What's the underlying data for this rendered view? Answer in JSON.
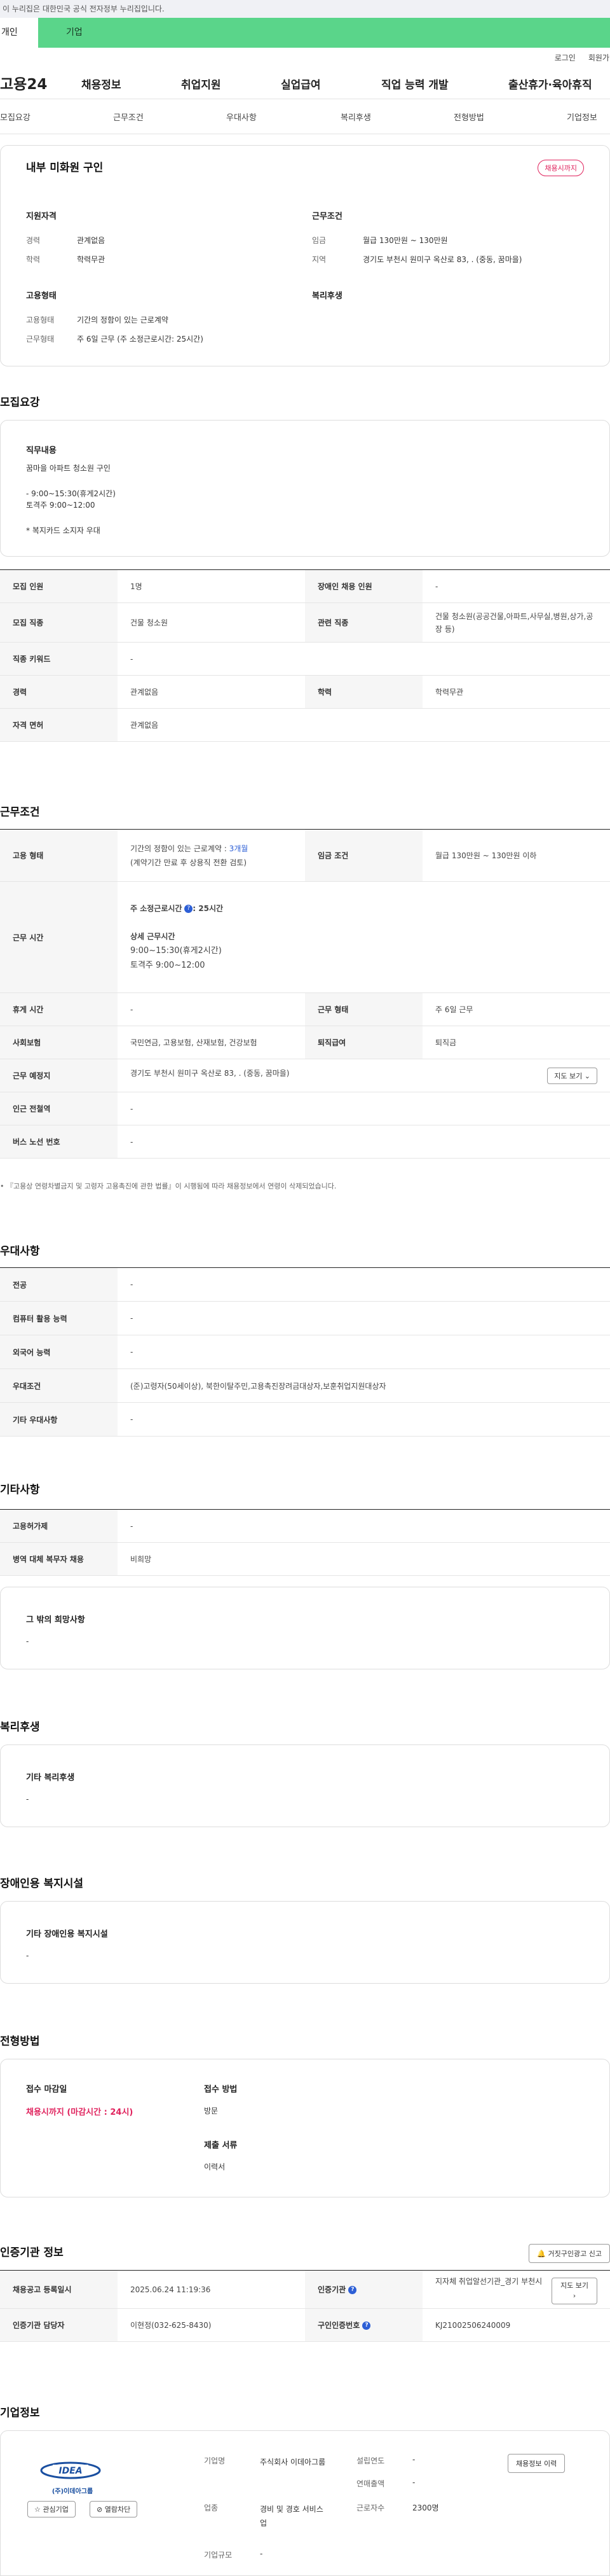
{
  "gov_banner": "이 누리집은 대한민국 공식 전자정부 누리집입니다.",
  "user_tabs": [
    "개인",
    "기업"
  ],
  "util": [
    "로그인",
    "회원가입"
  ],
  "logo": "고용24",
  "gnb": [
    "채용정보",
    "취업지원",
    "실업급여",
    "직업 능력 개발",
    "출산휴가·육아휴직"
  ],
  "snb": [
    "모집요강",
    "근무조건",
    "우대사항",
    "복리후생",
    "전형방법",
    "기업정보"
  ],
  "job": {
    "title": "내부 미화원 구인",
    "status": "채용시까지"
  },
  "summary": {
    "qual_title": "지원자격",
    "career_label": "경력",
    "career": "관계없음",
    "edu_label": "학력",
    "edu": "학력무관",
    "cond_title": "근무조건",
    "wage_label": "임금",
    "wage": "월급 130만원 ~ 130만원",
    "region_label": "지역",
    "region": "경기도 부천시 원미구 옥산로 83, . (중동, 꿈마을)",
    "emp_title": "고용형태",
    "emptype_label": "고용형태",
    "emptype": "기간의 정함이 있는 근로계약",
    "worktime_label": "근무형태",
    "worktime": "주 6일 근무 (주 소정근로시간: 25시간)",
    "welfare_title": "복리후생"
  },
  "recruit": {
    "title": "모집요강",
    "duty_title": "직무내용",
    "duty_lines": [
      "꿈마을 아파트 청소원 구인",
      "- 9:00~15:30(휴게2시간)",
      "토격주 9:00~12:00",
      "* 복지카드 소지자 우대"
    ],
    "rows": [
      {
        "l1": "모집 인원",
        "v1": "1명",
        "l2": "장애인 채용 인원",
        "v2": "-"
      },
      {
        "l1": "모집 직종",
        "v1": "건물 청소원",
        "l2": "관련 직종",
        "v2": "건물 청소원(공공건물,아파트,사무실,병원,상가,공장 등)"
      },
      {
        "l1": "직종 키워드",
        "v1": "-"
      },
      {
        "l1": "경력",
        "v1": "관계없음",
        "l2": "학력",
        "v2": "학력무관"
      },
      {
        "l1": "자격 면허",
        "v1": "관계없음"
      }
    ]
  },
  "conditions": {
    "title": "근무조건",
    "emp_label": "고용 형태",
    "emp_val": "기간의 정함이 있는 근로계약 : ",
    "emp_months": "3개월",
    "emp_note": "(계약기간 만료 후 상용직 전환 검토)",
    "wage_label": "임금 조건",
    "wage_val": "월급 130만원 ~ 130만원 이하",
    "hours_label": "근무 시간",
    "hours_std": "주 소정근로시간",
    "hours_std_val": ": 25시간",
    "hours_detail_title": "상세 근무시간",
    "hours_detail_1": "9:00~15:30(휴게2시간)",
    "hours_detail_2": "토격주 9:00~12:00",
    "break_label": "휴게 시간",
    "break_val": "-",
    "form_label": "근무 형태",
    "form_val": "주 6일 근무",
    "ins_label": "사회보험",
    "ins_val": "국민연금, 고용보험, 산재보험, 건강보험",
    "ret_label": "퇴직급여",
    "ret_val": "퇴직금",
    "place_label": "근무 예정지",
    "place_val": "경기도 부천시 원미구 옥산로 83, . (중동, 꿈마을)",
    "map_btn": "지도 보기",
    "subway_label": "인근 전철역",
    "subway_val": "-",
    "bus_label": "버스 노선 번호",
    "bus_val": "-",
    "footnote": "『고용상 연령차별금지 및 고령자 고용촉진에 관한 법률』이 시행됨에 따라 채용정보에서 연령이 삭제되었습니다."
  },
  "pref": {
    "title": "우대사항",
    "rows": [
      {
        "l": "전공",
        "v": "-"
      },
      {
        "l": "컴퓨터 활용 능력",
        "v": "-"
      },
      {
        "l": "외국어 능력",
        "v": "-"
      },
      {
        "l": "우대조건",
        "v": "(준)고령자(50세이상), 북한이탈주민,고용촉진장려금대상자,보훈취업지원대상자"
      },
      {
        "l": "기타 우대사항",
        "v": "-"
      }
    ]
  },
  "etc": {
    "title": "기타사항",
    "rows": [
      {
        "l": "고용허가제",
        "v": "-"
      },
      {
        "l": "병역 대체 복무자 채용",
        "v": "비희망"
      }
    ],
    "hope_title": "그 밖의 희망사항",
    "hope_val": "-"
  },
  "welfare": {
    "title": "복리후생",
    "box_title": "기타 복리후생",
    "box_val": "-"
  },
  "disabled": {
    "title": "장애인용 복지시설",
    "box_title": "기타 장애인용 복지시설",
    "box_val": "-"
  },
  "process": {
    "title": "전형방법",
    "deadline_label": "접수 마감일",
    "deadline_val": "채용시까지 (마감시간 : 24시)",
    "method_label": "접수 방법",
    "method_val": "방문",
    "docs_label": "제출 서류",
    "docs_val": "이력서"
  },
  "cert": {
    "title": "인증기관 정보",
    "report_btn": "거짓구인광고 신고",
    "reg_label": "채용공고 등록일시",
    "reg_val": "2025.06.24 11:19:36",
    "org_label": "인증기관",
    "org_val": "지자체 취업알선기관_경기 부천시",
    "map_btn": "지도 보기",
    "mgr_label": "인증기관 담당자",
    "mgr_val": "이현정(032-625-8430)",
    "num_label": "구인인증번호",
    "num_val": "KJ21002506240009"
  },
  "company": {
    "title": "기업정보",
    "logo_text": "(주)이데아그룹",
    "interest_btn": "관심기업",
    "block_btn": "열람차단",
    "name_label": "기업명",
    "name_val": "주식회사 이데아그룹",
    "industry_label": "업종",
    "industry_val": "경비 및 경호 서비스업",
    "size_label": "기업규모",
    "size_val": "-",
    "est_label": "설립연도",
    "est_val": "-",
    "sales_label": "연매출액",
    "sales_val": "-",
    "emp_label": "근로자수",
    "emp_val": "2300명",
    "hist_btn": "채용정보 이력"
  },
  "colors": {
    "accent": "#e0245e",
    "green": "#5ad58a",
    "blue": "#2d5fd6"
  }
}
